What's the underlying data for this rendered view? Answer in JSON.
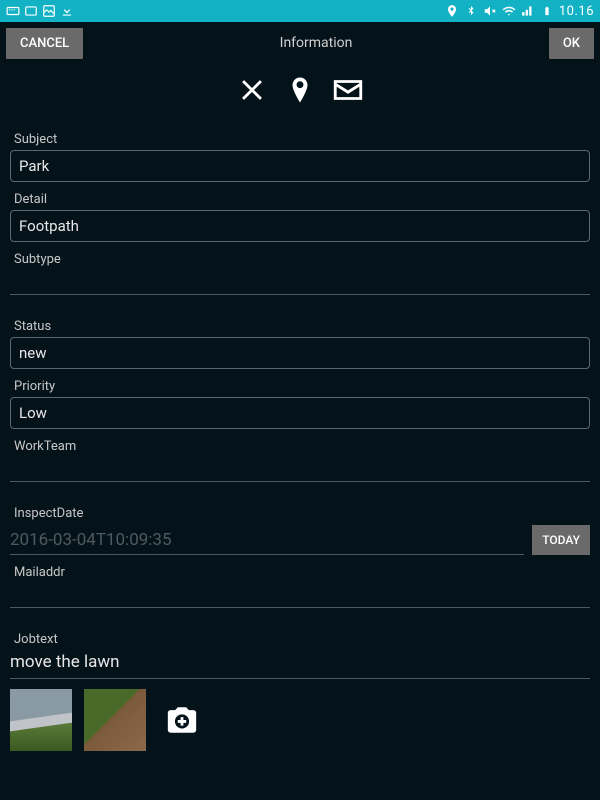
{
  "status_bar": {
    "time": "10.16"
  },
  "header": {
    "cancel_label": "CANCEL",
    "title": "Information",
    "ok_label": "OK"
  },
  "fields": {
    "subject": {
      "label": "Subject",
      "value": "Park"
    },
    "detail": {
      "label": "Detail",
      "value": "Footpath"
    },
    "subtype": {
      "label": "Subtype",
      "value": ""
    },
    "status": {
      "label": "Status",
      "value": "new"
    },
    "priority": {
      "label": "Priority",
      "value": "Low"
    },
    "workteam": {
      "label": "WorkTeam",
      "value": ""
    },
    "inspect_date": {
      "label": "InspectDate",
      "value": "2016-03-04T10:09:35",
      "today_label": "TODAY"
    },
    "mailaddr": {
      "label": "Mailaddr",
      "value": ""
    },
    "jobtext": {
      "label": "Jobtext",
      "value": "move the lawn"
    }
  }
}
